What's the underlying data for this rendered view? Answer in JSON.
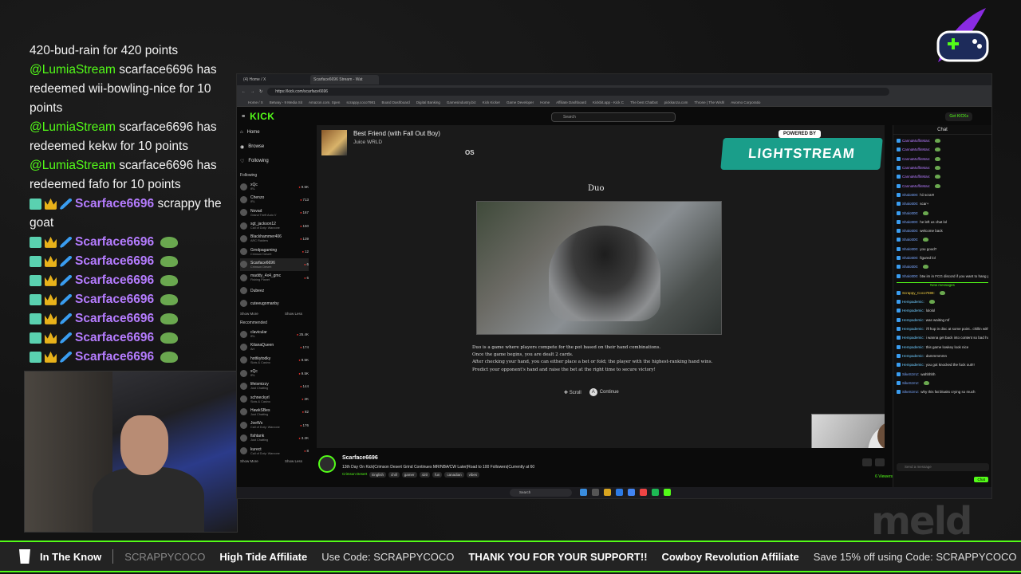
{
  "overlay_chat": {
    "intro_line": "420-bud-rain for 420 points",
    "redeems": [
      {
        "mention": "@LumiaStream",
        "text": "scarface6696 has redeemed wii-bowling-nice for 10 points"
      },
      {
        "mention": "@LumiaStream",
        "text": "scarface6696 has redeemed kekw for 10 points"
      },
      {
        "mention": "@LumiaStream",
        "text": "scarface6696 has redeemed fafo for 10 points"
      }
    ],
    "user_messages": [
      {
        "user": "Scarface6696",
        "text": "scrappy the goat"
      },
      {
        "user": "Scarface6696",
        "text": ""
      },
      {
        "user": "Scarface6696",
        "text": ""
      },
      {
        "user": "Scarface6696",
        "text": ""
      },
      {
        "user": "Scarface6696",
        "text": ""
      },
      {
        "user": "Scarface6696",
        "text": ""
      },
      {
        "user": "Scarface6696",
        "text": ""
      },
      {
        "user": "Scarface6696",
        "text": ""
      }
    ]
  },
  "browser": {
    "tabs": [
      {
        "label": "(4) Home / X"
      },
      {
        "label": "Scarface6696 Stream - Wat"
      }
    ],
    "url": "https://kick.com/scarface6696",
    "bookmarks": [
      "Home / X",
      "Betway - 9 Media Sit",
      "Amazon.com. Spen",
      "scrappy.coco7981",
      "Board Dashboard",
      "Digital Banking",
      "Gamesindustry.biz",
      "Kick Kicker",
      "Game Developer",
      "Home",
      "Affiliate Dashboard",
      "Kickbit.app - Kick C",
      "The best Chatbot",
      "pickkanza.com",
      "Throne | The Wishl",
      "Aviomo Corporatio"
    ]
  },
  "kick": {
    "logo": "KICK",
    "search_placeholder": "Search",
    "get_kicks": "Get KICKs",
    "nav": {
      "home": "Home",
      "browse": "Browse",
      "following": "Following"
    },
    "following_label": "Following",
    "recommended_label": "Recommended",
    "show_more": "Show More",
    "show_less": "Show Less",
    "following_channels": [
      {
        "name": "xQc",
        "game": "IRL",
        "viewers": "9.5K"
      },
      {
        "name": "Chenzo",
        "game": "IRL",
        "viewers": "713"
      },
      {
        "name": "Novad",
        "game": "Grand Theft Auto V",
        "viewers": "167"
      },
      {
        "name": "sgt_jackson12",
        "game": "Call of Duty: Warzone",
        "viewers": "150"
      },
      {
        "name": "Blackhammer406",
        "game": "ARC Raiders",
        "viewers": "139"
      },
      {
        "name": "Grndpagaming",
        "game": "Crimson Desert",
        "viewers": "12"
      },
      {
        "name": "Scarface6696",
        "game": "Crimson Desert",
        "viewers": "6"
      },
      {
        "name": "maddy_4x4_gmc",
        "game": "Fishing Planet",
        "viewers": "6"
      },
      {
        "name": "Dubeez",
        "game": "",
        "viewers": ""
      },
      {
        "name": "cuteeugomanby",
        "game": "",
        "viewers": ""
      }
    ],
    "recommended_channels": [
      {
        "name": "clavicular",
        "game": "IRL",
        "viewers": "25.4K"
      },
      {
        "name": "KitanaQueen",
        "game": "Art",
        "viewers": "174"
      },
      {
        "name": "hottkytodky",
        "game": "Slots & Casino",
        "viewers": "9.5K"
      },
      {
        "name": "xQc",
        "game": "IRL",
        "viewers": "9.5K"
      },
      {
        "name": "lifeismizzy",
        "game": "Just Chatting",
        "viewers": "144"
      },
      {
        "name": "schneckyrl",
        "game": "Slots & Casino",
        "viewers": "2K"
      },
      {
        "name": "HawkSBes",
        "game": "Just Chatting",
        "viewers": "82"
      },
      {
        "name": "JoeWs",
        "game": "Call of Duty: Warzone",
        "viewers": "176"
      },
      {
        "name": "fishtank",
        "game": "Just Chatting",
        "viewers": "3.2K"
      },
      {
        "name": "kurect",
        "game": "Call of Duty: Warzone",
        "viewers": "8"
      }
    ]
  },
  "stream": {
    "song_title": "Best Friend (with Fall Out Boy)",
    "song_artist": "Juice WRLD",
    "os_label": "OS",
    "powered_by": "POWERED BY",
    "lightstream": "LIGHTSTREAM",
    "game_title": "Duo",
    "game_description": [
      "Duo is a game where players compete for the pot based on their hand combinations.",
      "Once the game begins, you are dealt 2 cards.",
      "After checking your hand, you can either place a bet or fold; the player with the highest-ranking hand wins.",
      "Predict your opponent's hand and raise the bet at the right time to secure victory!"
    ],
    "scroll_label": "Scroll",
    "continue_label": "Continue",
    "continue_key": "A"
  },
  "stream_info": {
    "streamer": "Scarface6696",
    "title": "13th Day On Kick|Crimson Desert Grind Continues MR/NBA/CW Later|Road to 100 Followers|Currently at 60",
    "category": "Crimson Desert",
    "tags": [
      "English",
      "chill",
      "gamer",
      "420",
      "fun",
      "canadian",
      "vibes"
    ],
    "viewers": "6 Viewers"
  },
  "chat": {
    "header": "Chat",
    "messages": [
      {
        "user": "CannaMuffinMan:",
        "text": "",
        "cls": "u1"
      },
      {
        "user": "CannaMuffinMan:",
        "text": "",
        "cls": "u1"
      },
      {
        "user": "CannaMuffinMan:",
        "text": "",
        "cls": "u1"
      },
      {
        "user": "CannaMuffinMan:",
        "text": "",
        "cls": "u1"
      },
      {
        "user": "CannaMuffinMan:",
        "text": "",
        "cls": "u1"
      },
      {
        "user": "CannaMuffinMan:",
        "text": "",
        "cls": "u1"
      },
      {
        "user": "Shalott00:",
        "text": "hii scra!!!",
        "cls": "u2"
      },
      {
        "user": "Shalott00:",
        "text": "scar+",
        "cls": "u2"
      },
      {
        "user": "Shalott00:",
        "text": "",
        "cls": "u2"
      },
      {
        "user": "Shalott00:",
        "text": "he left us chat lol",
        "cls": "u2"
      },
      {
        "user": "Shalott00:",
        "text": "welcome back",
        "cls": "u2"
      },
      {
        "user": "Shalott00:",
        "text": "",
        "cls": "u2"
      },
      {
        "user": "Shalott00:",
        "text": "you good?",
        "cls": "u2"
      },
      {
        "user": "Shalott00:",
        "text": "figured lol",
        "cls": "u2"
      },
      {
        "user": "Shalott00:",
        "text": "",
        "cls": "u2"
      },
      {
        "user": "Shalott00:",
        "text": "btw im in FCG discord if you want to hang pout while we stream",
        "cls": "u2"
      }
    ],
    "new_messages_label": "New messages",
    "new_messages": [
      {
        "user": "Scrappy_Coco7598:",
        "text": "",
        "cls": "u3"
      },
      {
        "user": "Hempademic:",
        "text": "",
        "cls": "u4"
      },
      {
        "user": "Hempademic:",
        "text": "lololol",
        "cls": "u4"
      },
      {
        "user": "Hempademic:",
        "text": "was waiting mf",
        "cls": "u4"
      },
      {
        "user": "Hempademic:",
        "text": "i'll hop in disc at some point.. chillin with girl",
        "cls": "u4"
      },
      {
        "user": "Hempademic:",
        "text": "i wanna get back into content so bad honestly",
        "cls": "u4"
      },
      {
        "user": "Hempademic:",
        "text": "this game lowkey look nice",
        "cls": "u4"
      },
      {
        "user": "Hempademic:",
        "text": "dammmmmn",
        "cls": "u4"
      },
      {
        "user": "Hempademic:",
        "text": "you got knocked the fuck out!!!",
        "cls": "u4"
      },
      {
        "user": "SikeSzmz:",
        "text": "wahhhhh",
        "cls": "u2"
      },
      {
        "user": "SikeSzmz:",
        "text": "",
        "cls": "u2"
      },
      {
        "user": "SikeSzmz:",
        "text": "why this fat bloaks crying so much",
        "cls": "u2"
      }
    ],
    "input_placeholder": "Send a message",
    "send_label": "Chat"
  },
  "taskbar": {
    "search": "Search"
  },
  "ticker": {
    "items": [
      {
        "bold": "In The Know",
        "text": "SCRAPPYCOCO",
        "dim": true
      },
      {
        "bold": "High Tide Affiliate",
        "text": "Use Code: SCRAPPYCOCO",
        "dim": false
      },
      {
        "bold": "THANK YOU FOR YOUR SUPPORT!!",
        "text": "",
        "dim": false
      },
      {
        "bold": "Cowboy Revolution Affiliate",
        "text": "Save 15% off using Code: SCRAPPYCOCO",
        "dim": false
      }
    ]
  },
  "watermark": "meld",
  "colors": {
    "kick_green": "#53fc18",
    "purple_user": "#b57cff",
    "lightstream_teal": "#1a9e8a"
  }
}
